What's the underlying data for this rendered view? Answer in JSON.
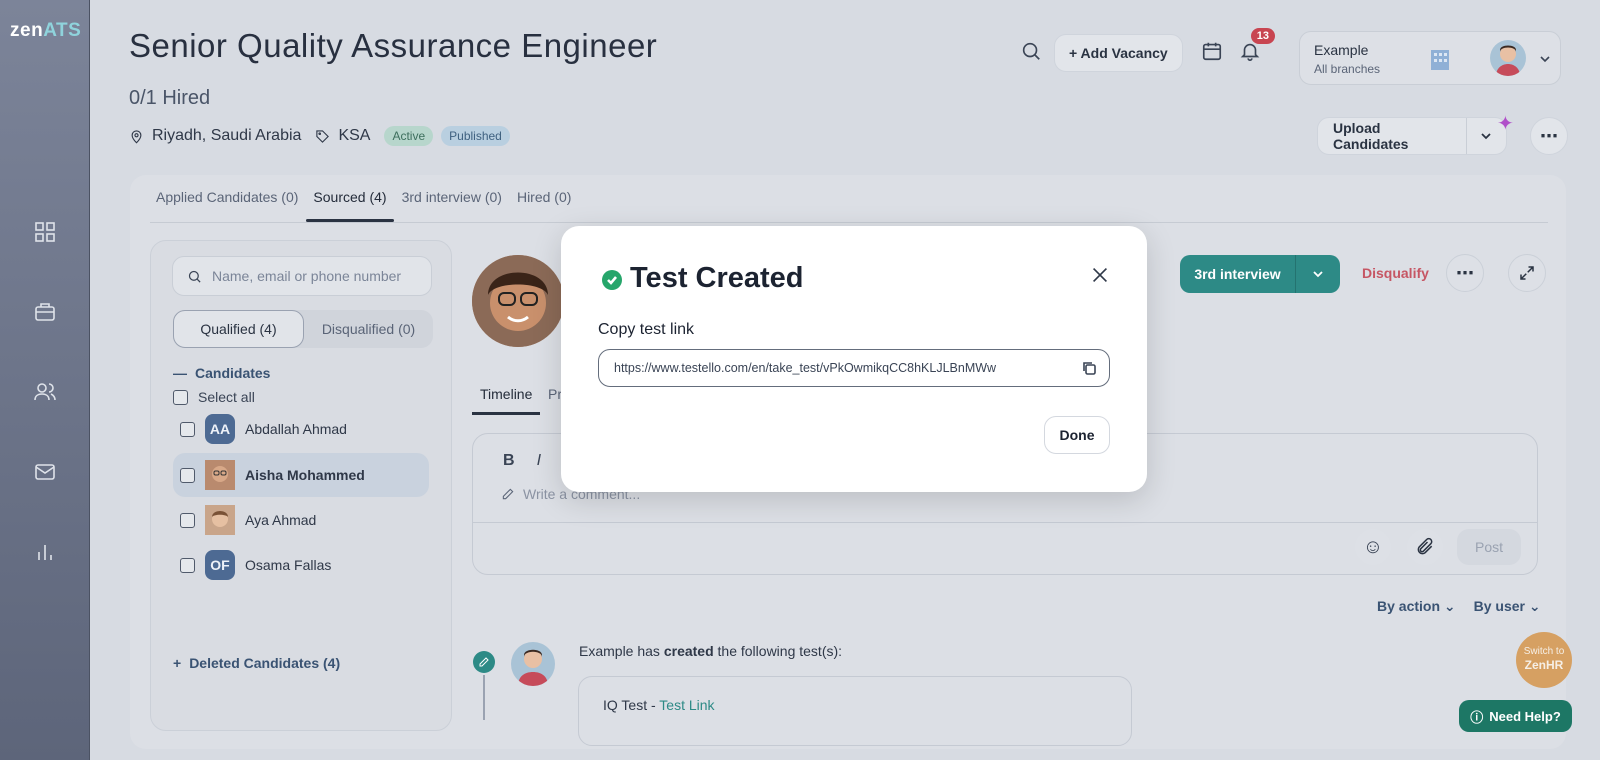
{
  "app": {
    "logo_main": "zen",
    "logo_accent": "ATS"
  },
  "job": {
    "title": "Senior Quality Assurance Engineer",
    "hired": "0/1 Hired",
    "location": "Riyadh, Saudi Arabia",
    "tag": "KSA",
    "status_active": "Active",
    "status_published": "Published"
  },
  "header": {
    "add_vacancy": "+ Add Vacancy",
    "notifications_count": "13",
    "account_name": "Example",
    "account_sub": "All branches",
    "upload_candidates": "Upload Candidates"
  },
  "tabs": [
    {
      "label": "Applied Candidates (0)"
    },
    {
      "label": "Sourced (4)"
    },
    {
      "label": "3rd interview (0)"
    },
    {
      "label": "Hired (0)"
    }
  ],
  "candidates_panel": {
    "search_placeholder": "Name, email or phone number",
    "qualified": "Qualified (4)",
    "disqualified": "Disqualified (0)",
    "header": "Candidates",
    "select_all": "Select all",
    "items": [
      {
        "initials": "AA",
        "name": "Abdallah Ahmad"
      },
      {
        "initials": "",
        "name": "Aisha Mohammed"
      },
      {
        "initials": "",
        "name": "Aya Ahmad"
      },
      {
        "initials": "OF",
        "name": "Osama Fallas"
      }
    ],
    "deleted": "Deleted Candidates (4)"
  },
  "profile": {
    "stage_button": "3rd interview",
    "disqualify": "Disqualify",
    "tab_timeline": "Timeline",
    "tab_partial": "Pr",
    "comment_placeholder": "Write a comment...",
    "post": "Post",
    "filter_action": "By action",
    "filter_user": "By user"
  },
  "timeline": {
    "actor": "Example",
    "text_mid": "has",
    "verb": "created",
    "text_end": "the following test(s):",
    "test_name": "IQ Test - ",
    "test_link": "Test Link"
  },
  "floating": {
    "switch_line1": "Switch to",
    "switch_line2": "ZenHR",
    "help": "Need Help?"
  },
  "modal": {
    "title": "Test Created",
    "label": "Copy test link",
    "link": "https://www.testello.com/en/take_test/vPkOwmikqCC8hKLJLBnMWw",
    "done": "Done"
  },
  "colors": {
    "teal": "#2d8a86",
    "success": "#26a66b",
    "danger": "#c65664",
    "badge": "#c84551"
  }
}
